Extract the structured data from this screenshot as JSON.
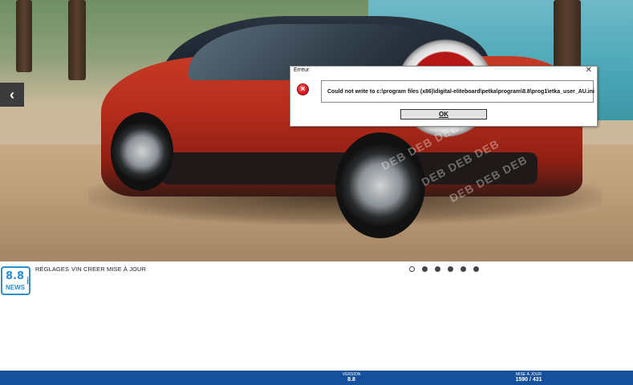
{
  "dialog": {
    "title": "Erreur",
    "close_glyph": "✕",
    "icon": "error-icon",
    "message": "Could not write to c:\\program files (x86)\\digital-eliteboard\\petka\\program\\8.8\\prog1\\etka_user_AU.ini",
    "ok_label": "OK"
  },
  "hero": {
    "prev_glyph": "‹",
    "watermark": "DEB DEB DEB"
  },
  "logo": {
    "version": "8.8",
    "news": "NEWS"
  },
  "menu": {
    "items": [
      {
        "label": "RÉGLAGES"
      },
      {
        "label": "VIN CREER"
      },
      {
        "label": "MISE À JOUR"
      }
    ]
  },
  "carousel": {
    "count": 6,
    "active_index": 0
  },
  "statusbar": {
    "version_label": "VERSION",
    "version_value": "8.8",
    "update_label": "MISE À JOUR",
    "update_value": "1590 / 431"
  },
  "colors": {
    "statusbar": "#17509a",
    "accent": "#2b8ed1",
    "error": "#d91c1c"
  }
}
